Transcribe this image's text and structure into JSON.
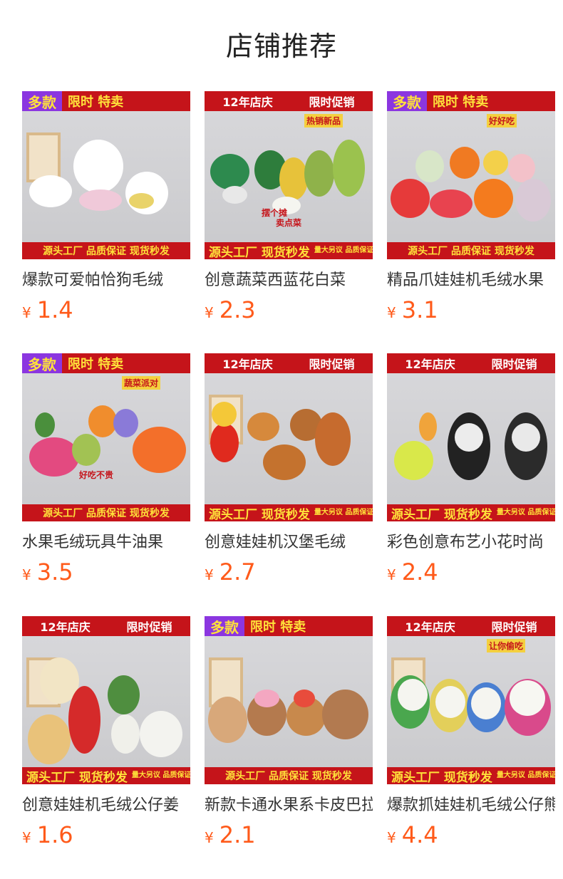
{
  "page_title": "店铺推荐",
  "currency_symbol": "¥",
  "products": [
    {
      "name": "爆款可爱帕恰狗毛绒",
      "price": "1.4",
      "top_left": "多款",
      "top_right": "限时 特卖",
      "bottom": "源头工厂 品质保证 现货秒发",
      "top_style": "a",
      "bottom_style": "plain",
      "scene": "dogs"
    },
    {
      "name": "创意蔬菜西蓝花白菜",
      "price": "2.3",
      "top_left": "12年店庆",
      "top_right": "限时促销",
      "bottom": "源头工厂 现货秒发",
      "bottom_small": "量大另议 品质保证",
      "top_style": "b",
      "bottom_style": "big",
      "scene": "veg",
      "extra": [
        "热销新品",
        "摆个摊",
        "卖点菜"
      ]
    },
    {
      "name": "精品爪娃娃机毛绒水果",
      "price": "3.1",
      "top_left": "多款",
      "top_right": "限时 特卖",
      "bottom": "源头工厂 品质保证 现货秒发",
      "top_style": "a",
      "bottom_style": "plain",
      "scene": "fruit",
      "extra": [
        "好好吃"
      ]
    },
    {
      "name": "水果毛绒玩具牛油果",
      "price": "3.5",
      "top_left": "多款",
      "top_right": "限时 特卖",
      "bottom": "源头工厂 品质保证 现货秒发",
      "top_style": "a",
      "bottom_style": "plain",
      "scene": "fruit2",
      "extra": [
        "蔬菜派对",
        "好吃不贵"
      ]
    },
    {
      "name": "创意娃娃机汉堡毛绒",
      "price": "2.7",
      "top_left": "12年店庆",
      "top_right": "限时促销",
      "bottom": "源头工厂 现货秒发",
      "bottom_small": "量大另议 品质保证",
      "top_style": "b",
      "bottom_style": "big",
      "scene": "food"
    },
    {
      "name": "彩色创意布艺小花时尚",
      "price": "2.4",
      "top_left": "12年店庆",
      "top_right": "限时促销",
      "bottom": "源头工厂 现货秒发",
      "bottom_small": "量大另议 品质保证",
      "top_style": "b",
      "bottom_style": "big",
      "scene": "flower"
    },
    {
      "name": "创意娃娃机毛绒公仔姜",
      "price": "1.6",
      "top_left": "12年店庆",
      "top_right": "限时促销",
      "bottom": "源头工厂 现货秒发",
      "bottom_small": "量大另议 品质保证",
      "top_style": "b",
      "bottom_style": "big",
      "scene": "ginger"
    },
    {
      "name": "新款卡通水果系卡皮巴拉",
      "price": "2.1",
      "top_left": "多款",
      "top_right": "限时 特卖",
      "bottom": "源头工厂 品质保证 现货秒发",
      "top_style": "a",
      "bottom_style": "plain",
      "scene": "capy"
    },
    {
      "name": "爆款抓娃娃机毛绒公仔熊",
      "price": "4.4",
      "top_left": "12年店庆",
      "top_right": "限时促销",
      "bottom": "源头工厂 现货秒发",
      "bottom_small": "量大另议 品质保证",
      "top_style": "b",
      "bottom_style": "big",
      "scene": "bears",
      "extra": [
        "让你偷吃"
      ]
    }
  ]
}
